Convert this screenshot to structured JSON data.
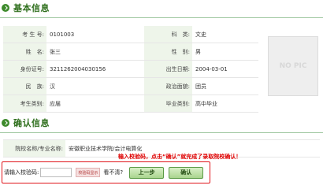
{
  "basic_section": {
    "title": "基本信息"
  },
  "fields": {
    "exam_no_label": "考 生 号:",
    "exam_no": "0101003",
    "subject_label": "科　类:",
    "subject": "文史",
    "name_label": "姓　名:",
    "name": "张三",
    "gender_label": "性　别:",
    "gender": "男",
    "id_label": "身份证号:",
    "id_number": "3211262004030156",
    "dob_label": "出生日期:",
    "dob": "2004-03-01",
    "ethnic_label": "民　族:",
    "ethnic": "汉",
    "political_label": "政治面貌:",
    "political": "团员",
    "category_label": "考生类别:",
    "category": "应届",
    "grad_label": "毕业类别:",
    "grad": "高中毕业"
  },
  "photo": {
    "placeholder": "NO PIC"
  },
  "confirm_section": {
    "title": "确认信息"
  },
  "school": {
    "label": "院校名称/专业名称:",
    "value": "安徽职业技术学院/会计电算化"
  },
  "notice": "输入校验码，点击“确认”就完成了录取院校确认！",
  "verify": {
    "label": "请输入校验码:",
    "input_value": "",
    "captcha_text": "校验码显示",
    "refresh_text": "看不清?",
    "prev_button": "上一步",
    "confirm_button": "确认"
  }
}
